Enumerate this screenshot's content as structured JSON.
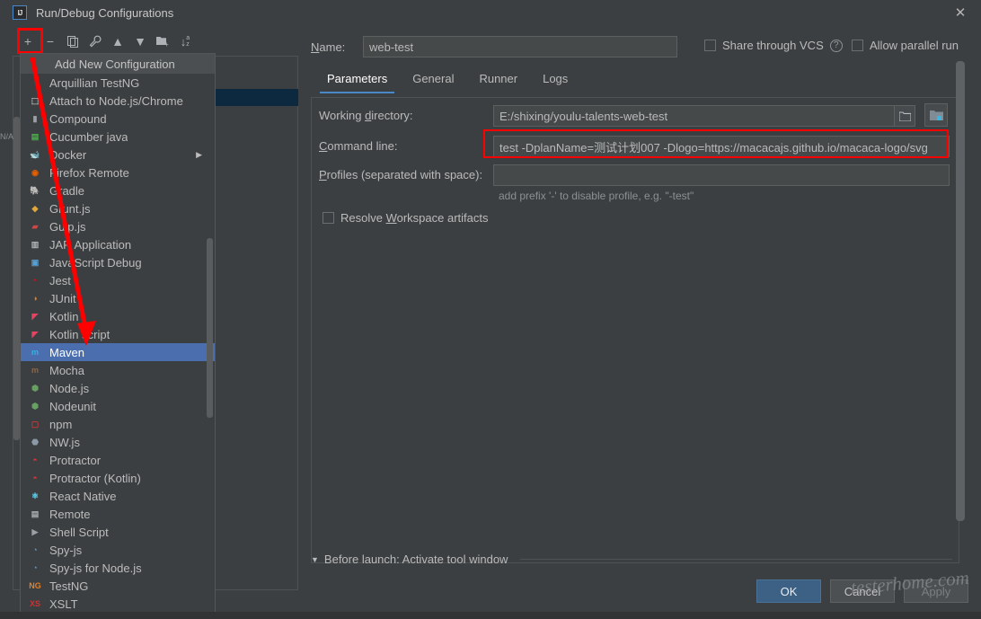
{
  "window": {
    "title": "Run/Debug Configurations",
    "logo_text": "IJ",
    "close_icon": "✕"
  },
  "toolbar": {
    "items": [
      {
        "name": "add-configuration-button",
        "glyph": "+"
      },
      {
        "name": "remove-configuration-button",
        "glyph": "−"
      },
      {
        "name": "copy-configuration-button",
        "glyph": "❐"
      },
      {
        "name": "edit-templates-button",
        "glyph": "🔧"
      },
      {
        "name": "move-up-button",
        "glyph": "▲"
      },
      {
        "name": "move-down-button",
        "glyph": "▼"
      },
      {
        "name": "move-into-folder-button",
        "glyph": "🗀"
      },
      {
        "name": "sort-configurations-button",
        "glyph": "↓az"
      }
    ]
  },
  "popup": {
    "header": "Add New Configuration",
    "items": [
      {
        "label": "Arquillian TestNG",
        "icon": "arquillian-icon",
        "color": "#b7bd3a",
        "bg": "#3c3f41",
        "glyph": "◔",
        "submenu": false
      },
      {
        "label": "Attach to Node.js/Chrome",
        "icon": "nodejs-attach-icon",
        "color": "#d2d2d2",
        "bg": "#3c3f41",
        "glyph": "⬚",
        "submenu": false
      },
      {
        "label": "Compound",
        "icon": "compound-icon",
        "color": "#9aa0a6",
        "bg": "#3c3f41",
        "glyph": "▮",
        "submenu": false
      },
      {
        "label": "Cucumber java",
        "icon": "cucumber-icon",
        "color": "#4cae4c",
        "bg": "#3c3f41",
        "glyph": "▤",
        "submenu": false
      },
      {
        "label": "Docker",
        "icon": "docker-icon",
        "color": "#2496ed",
        "bg": "#3c3f41",
        "glyph": "🐋",
        "submenu": true
      },
      {
        "label": "Firefox Remote",
        "icon": "firefox-icon",
        "color": "#e66000",
        "bg": "#3c3f41",
        "glyph": "◉",
        "submenu": false
      },
      {
        "label": "Gradle",
        "icon": "gradle-icon",
        "color": "#9fa2a5",
        "bg": "#3c3f41",
        "glyph": "🐘",
        "submenu": false
      },
      {
        "label": "Grunt.js",
        "icon": "grunt-icon",
        "color": "#e3a83b",
        "bg": "#3c3f41",
        "glyph": "◆",
        "submenu": false
      },
      {
        "label": "Gulp.js",
        "icon": "gulp-icon",
        "color": "#cf4647",
        "bg": "#3c3f41",
        "glyph": "▰",
        "submenu": false
      },
      {
        "label": "JAR Application",
        "icon": "jar-icon",
        "color": "#b0b3b6",
        "bg": "#3c3f41",
        "glyph": "▥",
        "submenu": false
      },
      {
        "label": "JavaScript Debug",
        "icon": "js-debug-icon",
        "color": "#5a9fd4",
        "bg": "#3c3f41",
        "glyph": "▣",
        "submenu": false
      },
      {
        "label": "Jest",
        "icon": "jest-icon",
        "color": "#c21325",
        "bg": "#3c3f41",
        "glyph": "◓",
        "submenu": false
      },
      {
        "label": "JUnit",
        "icon": "junit-icon",
        "color": "#ea7d24",
        "bg": "#3c3f41",
        "glyph": "◑",
        "submenu": false
      },
      {
        "label": "Kotlin",
        "icon": "kotlin-icon",
        "color": "#e24462",
        "bg": "#3c3f41",
        "glyph": "◤",
        "submenu": false
      },
      {
        "label": "Kotlin script",
        "icon": "kotlin-script-icon",
        "color": "#e24462",
        "bg": "#3c3f41",
        "glyph": "◤",
        "submenu": false
      },
      {
        "label": "Maven",
        "icon": "maven-icon",
        "color": "#38b0e0",
        "bg": "#4b6eaf",
        "glyph": "m",
        "submenu": false,
        "selected": true
      },
      {
        "label": "Mocha",
        "icon": "mocha-icon",
        "color": "#8d6748",
        "bg": "#3c3f41",
        "glyph": "m",
        "submenu": false
      },
      {
        "label": "Node.js",
        "icon": "nodejs-icon",
        "color": "#68a063",
        "bg": "#3c3f41",
        "glyph": "⬢",
        "submenu": false
      },
      {
        "label": "Nodeunit",
        "icon": "nodeunit-icon",
        "color": "#68a063",
        "bg": "#3c3f41",
        "glyph": "⬢",
        "submenu": false
      },
      {
        "label": "npm",
        "icon": "npm-icon",
        "color": "#cb3837",
        "bg": "#3c3f41",
        "glyph": "▢",
        "submenu": false
      },
      {
        "label": "NW.js",
        "icon": "nwjs-icon",
        "color": "#8b9aa8",
        "bg": "#3c3f41",
        "glyph": "⬣",
        "submenu": false
      },
      {
        "label": "Protractor",
        "icon": "protractor-icon",
        "color": "#e23237",
        "bg": "#3c3f41",
        "glyph": "◓",
        "submenu": false
      },
      {
        "label": "Protractor (Kotlin)",
        "icon": "protractor-kotlin-icon",
        "color": "#e23237",
        "bg": "#3c3f41",
        "glyph": "◓",
        "submenu": false
      },
      {
        "label": "React Native",
        "icon": "react-native-icon",
        "color": "#61dafb",
        "bg": "#3c3f41",
        "glyph": "⚛",
        "submenu": false
      },
      {
        "label": "Remote",
        "icon": "remote-icon",
        "color": "#aab0b5",
        "bg": "#3c3f41",
        "glyph": "▤",
        "submenu": false
      },
      {
        "label": "Shell Script",
        "icon": "shell-script-icon",
        "color": "#9aa0a6",
        "bg": "#3c3f41",
        "glyph": "▶",
        "submenu": false
      },
      {
        "label": "Spy-js",
        "icon": "spyjs-icon",
        "color": "#5b9bd5",
        "bg": "#3c3f41",
        "glyph": "◔",
        "submenu": false
      },
      {
        "label": "Spy-js for Node.js",
        "icon": "spyjs-node-icon",
        "color": "#5b9bd5",
        "bg": "#3c3f41",
        "glyph": "◔",
        "submenu": false
      },
      {
        "label": "TestNG",
        "icon": "testng-icon",
        "color": "#e0802a",
        "bg": "#3c3f41",
        "glyph": "NG",
        "submenu": false
      },
      {
        "label": "XSLT",
        "icon": "xslt-icon",
        "color": "#cc3333",
        "bg": "#3c3f41",
        "glyph": "XS",
        "submenu": false
      }
    ]
  },
  "form": {
    "name_label": "Name:",
    "name_value": "web-test",
    "share_vcs_label": "Share through VCS",
    "share_vcs_checked": false,
    "help_glyph": "?",
    "allow_parallel_label": "Allow parallel run",
    "allow_parallel_checked": false,
    "tabs": [
      {
        "label": "Parameters",
        "active": true
      },
      {
        "label": "General",
        "active": false
      },
      {
        "label": "Runner",
        "active": false
      },
      {
        "label": "Logs",
        "active": false
      }
    ],
    "working_directory_label": "Working directory:",
    "working_directory_value": "E:/shixing/youlu-talents-web-test",
    "browse_icon": "folder-icon",
    "module_icon": "module-folder-icon",
    "command_line_label": "Command line:",
    "command_line_value": "test -DplanName=测试计划007 -Dlogo=https://macacajs.github.io/macaca-logo/svg",
    "profiles_label": "Profiles (separated with space):",
    "profiles_value": "",
    "profiles_hint": "add prefix '-' to disable profile, e.g. \"-test\"",
    "resolve_workspace_label": "Resolve Workspace artifacts",
    "resolve_workspace_checked": false
  },
  "before_launch": {
    "collapse_glyph": "▼",
    "label": "Before launch: Activate tool window"
  },
  "buttons": {
    "ok": "OK",
    "cancel": "Cancel",
    "apply": "Apply"
  },
  "watermark": "testerhome.com",
  "left_edge_text": "N/A",
  "colors": {
    "window_bg": "#3c3f41",
    "selection_blue": "#4b6eaf",
    "tree_selection": "#0d293f",
    "accent_blue": "#4a88c7",
    "annotation_red": "#fe0000",
    "primary_button": "#3d6185"
  }
}
